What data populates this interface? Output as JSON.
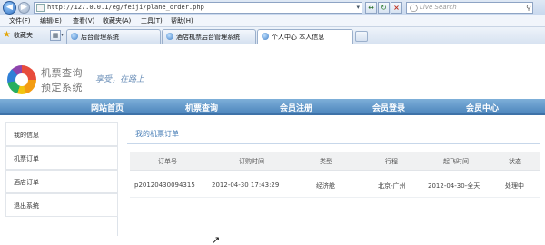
{
  "browser": {
    "url": "http://127.0.0.1/eg/feiji/plane_order.php",
    "search_placeholder": "Live Search",
    "menu": [
      "文件(F)",
      "编辑(E)",
      "查看(V)",
      "收藏夹(A)",
      "工具(T)",
      "帮助(H)"
    ],
    "favorites_label": "收藏夹",
    "tabs": [
      {
        "label": "后台管理系统",
        "active": false
      },
      {
        "label": "酒店机票后台管理系统",
        "active": false
      },
      {
        "label": "个人中心 本人信息",
        "active": true
      }
    ],
    "icons": {
      "back": "back-arrow-icon",
      "forward": "forward-arrow-icon",
      "refresh": "refresh-icon",
      "stop": "stop-icon",
      "search": "search-icon",
      "favorites": "star-icon"
    }
  },
  "site": {
    "logo_line1": "机票查询",
    "logo_line2": "预定系统",
    "slogan": "享受，在路上",
    "nav": [
      "网站首页",
      "机票查询",
      "会员注册",
      "会员登录",
      "会员中心"
    ]
  },
  "sidebar": {
    "items": [
      "我的信息",
      "机票订单",
      "酒店订单",
      "退出系统"
    ]
  },
  "orders": {
    "title": "我的机票订单",
    "columns": [
      "订单号",
      "订购时间",
      "类型",
      "行程",
      "起飞时间",
      "状态"
    ],
    "rows": [
      {
        "order_no": "p20120430094315",
        "order_time": "2012-04-30 17:43:29",
        "type": "经济舱",
        "route": "北京-广州",
        "departure": "2012-04-30-全天",
        "status": "处理中"
      }
    ]
  },
  "colors": {
    "nav_bar": "#4d86bd",
    "title_blue": "#4a7fb7",
    "table_header_bg": "#f0f1f2"
  }
}
